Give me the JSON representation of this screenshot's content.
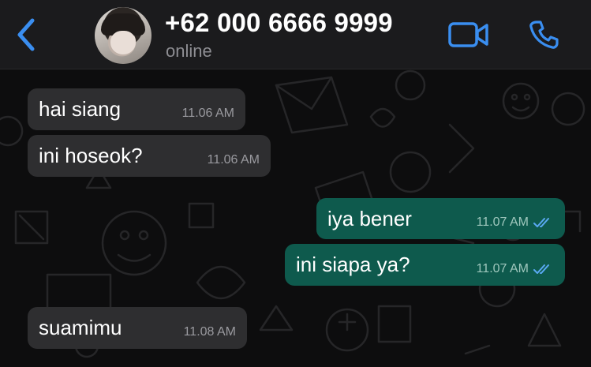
{
  "header": {
    "back_icon": "chevron-left-icon",
    "contact_name": "+62 000 6666 9999",
    "contact_status": "online",
    "video_icon": "video-camera-icon",
    "call_icon": "phone-icon",
    "accent_color": "#3a8ef0"
  },
  "chat": {
    "messages": [
      {
        "direction": "incoming",
        "text": "hai siang",
        "time": "11.06 AM"
      },
      {
        "direction": "incoming",
        "text": "ini hoseok?",
        "time": "11.06 AM"
      },
      {
        "direction": "outgoing",
        "text": "iya bener",
        "time": "11.07 AM",
        "status_icon": "double-check-icon"
      },
      {
        "direction": "outgoing",
        "text": "ini siapa ya?",
        "time": "11.07 AM",
        "status_icon": "double-check-icon"
      },
      {
        "direction": "incoming",
        "text": "suamimu",
        "time": "11.08 AM"
      }
    ]
  },
  "colors": {
    "incoming_bubble": "#2e2e30",
    "outgoing_bubble": "#0e5a4d",
    "read_receipt": "#5aa9f3"
  }
}
